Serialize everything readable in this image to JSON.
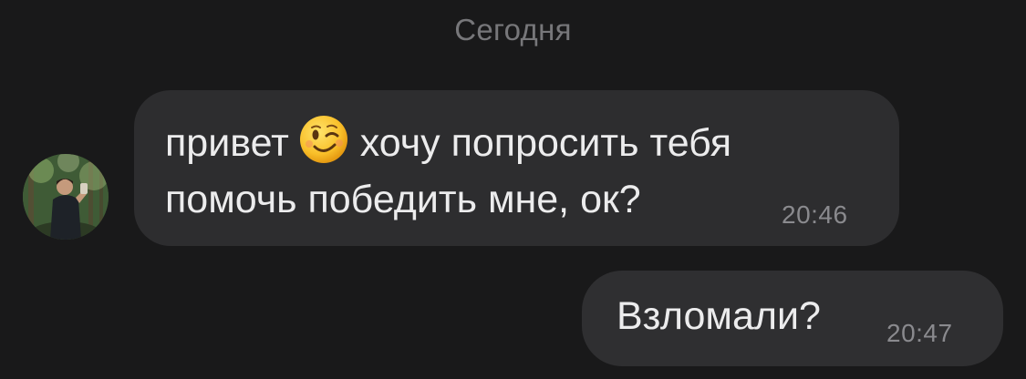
{
  "chat": {
    "date_separator": "Сегодня",
    "messages": [
      {
        "direction": "incoming",
        "line1_before_emoji": "привет",
        "emoji": "winking-face-icon",
        "line1_after_emoji": "хочу попросить тебя",
        "line2": "помочь победить мне, ок?",
        "time": "20:46"
      },
      {
        "direction": "outgoing",
        "text": "Взломали?",
        "time": "20:47"
      }
    ]
  },
  "colors": {
    "background": "#19191a",
    "bubble": "#2d2d2f",
    "text": "#ececed",
    "muted": "#77777a"
  }
}
